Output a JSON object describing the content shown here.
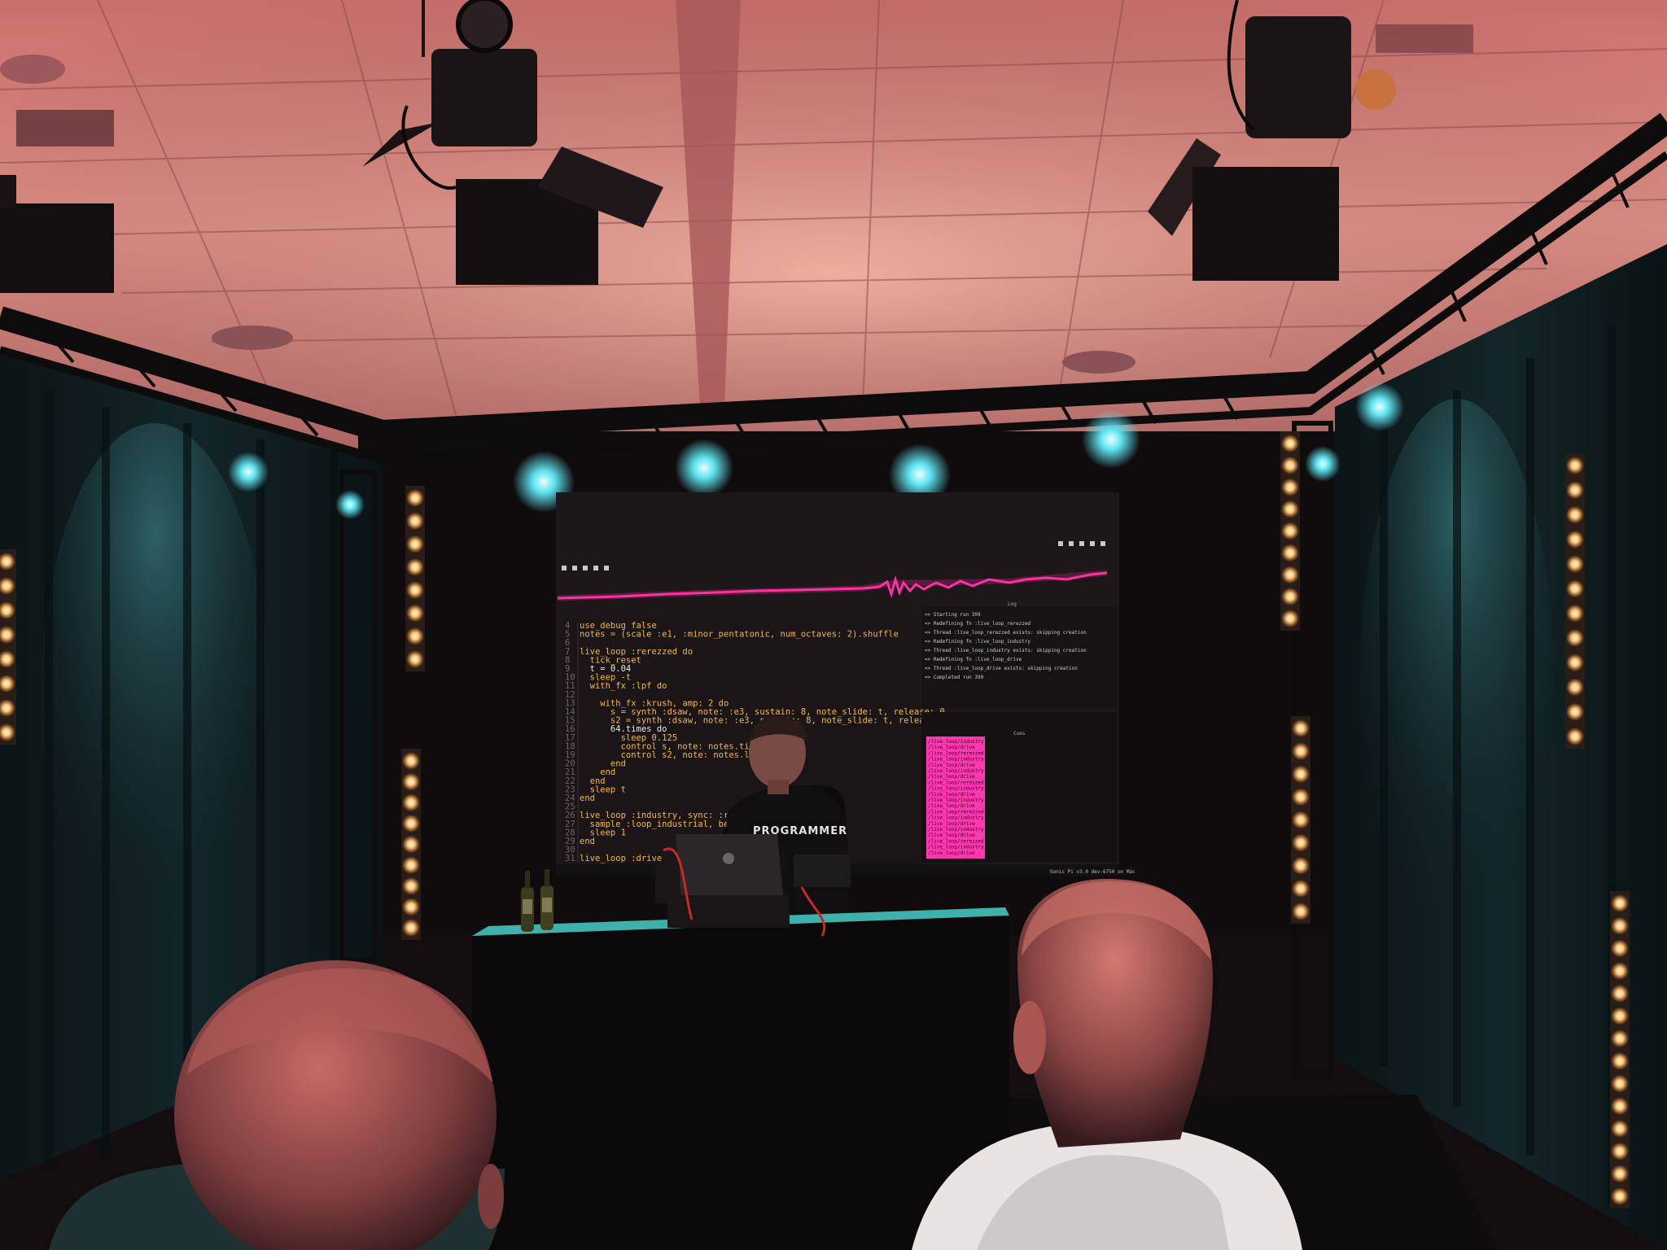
{
  "colors": {
    "ceiling_light": "#e89a8c",
    "ceiling_dark": "#7a3f44",
    "truss": "#121012",
    "curtain": "#0c1618",
    "screen_bg": "#1d1719",
    "scope_line": "#ff2fa5",
    "spot_cyan": "#5fe3f0",
    "bulb_warm": "#ffd9a0",
    "code_default": "#e8e8e8",
    "code_keyword": "#f5b942",
    "code_symbol": "#d86ad0",
    "code_number": "#4fd6ff",
    "log_highlight": "#ff37b0"
  },
  "scene": {
    "description_tags": [
      "live-coding-performance",
      "sonic-pi",
      "stage",
      "audience"
    ],
    "screen": {
      "code_lines": [
        {
          "n": "4",
          "text": "use_debug false"
        },
        {
          "n": "5",
          "text": "notes = (scale :e1, :minor_pentatonic, num_octaves: 2).shuffle"
        },
        {
          "n": "6",
          "text": ""
        },
        {
          "n": "7",
          "text": "live_loop :rerezzed do"
        },
        {
          "n": "8",
          "text": "  tick_reset"
        },
        {
          "n": "9",
          "text": "  t = 0.04"
        },
        {
          "n": "10",
          "text": "  sleep -t"
        },
        {
          "n": "11",
          "text": "  with_fx :lpf do"
        },
        {
          "n": "12",
          "text": ""
        },
        {
          "n": "13",
          "text": "    with_fx :krush, amp: 2 do"
        },
        {
          "n": "14",
          "text": "      s = synth :dsaw, note: :e3, sustain: 8, note_slide: t, release: 0"
        },
        {
          "n": "15",
          "text": "      s2 = synth :dsaw, note: :e3, sustain: 8, note_slide: t, release: 0"
        },
        {
          "n": "16",
          "text": "      64.times do"
        },
        {
          "n": "17",
          "text": "        sleep 0.125"
        },
        {
          "n": "18",
          "text": "        control s, note: notes.tick"
        },
        {
          "n": "19",
          "text": "        control s2, note: notes.look"
        },
        {
          "n": "20",
          "text": "      end"
        },
        {
          "n": "21",
          "text": "    end"
        },
        {
          "n": "22",
          "text": "  end"
        },
        {
          "n": "23",
          "text": "  sleep t"
        },
        {
          "n": "24",
          "text": "end"
        },
        {
          "n": "25",
          "text": ""
        },
        {
          "n": "26",
          "text": "live_loop :industry, sync: :rerezzed do"
        },
        {
          "n": "27",
          "text": "  sample :loop_industrial, beat_stret"
        },
        {
          "n": "28",
          "text": "  sleep 1"
        },
        {
          "n": "29",
          "text": "end"
        },
        {
          "n": "30",
          "text": ""
        },
        {
          "n": "31",
          "text": "live_loop :drive"
        }
      ],
      "log_title": "Log",
      "log_entries": [
        "=> Starting run 399",
        "=> Redefining fn :live_loop_rerezzed",
        "=> Thread :live_loop_rerezzed exists: skipping creation",
        "=> Redefining fn :live_loop_industry",
        "=> Thread :live_loop_industry exists: skipping creation",
        "=> Redefining fn :live_loop_drive",
        "=> Thread :live_loop_drive exists: skipping creation",
        "=> Completed run 399"
      ],
      "cue_title": "Cues",
      "cue_entries": [
        "/live_loop/industry",
        "/live_loop/drive",
        "/live_loop/rerezzed",
        "/live_loop/industry",
        "/live_loop/drive",
        "/live_loop/industry",
        "/live_loop/drive",
        "/live_loop/rerezzed",
        "/live_loop/industry",
        "/live_loop/drive",
        "/live_loop/industry",
        "/live_loop/drive",
        "/live_loop/rerezzed",
        "/live_loop/industry",
        "/live_loop/drive",
        "/live_loop/industry",
        "/live_loop/drive",
        "/live_loop/rerezzed",
        "/live_loop/industry",
        "/live_loop/drive"
      ],
      "status_bar": "Sonic Pi v3.0 dev-6750 on Mac"
    },
    "performer": {
      "shirt_text": "PROGRAMMER"
    }
  }
}
